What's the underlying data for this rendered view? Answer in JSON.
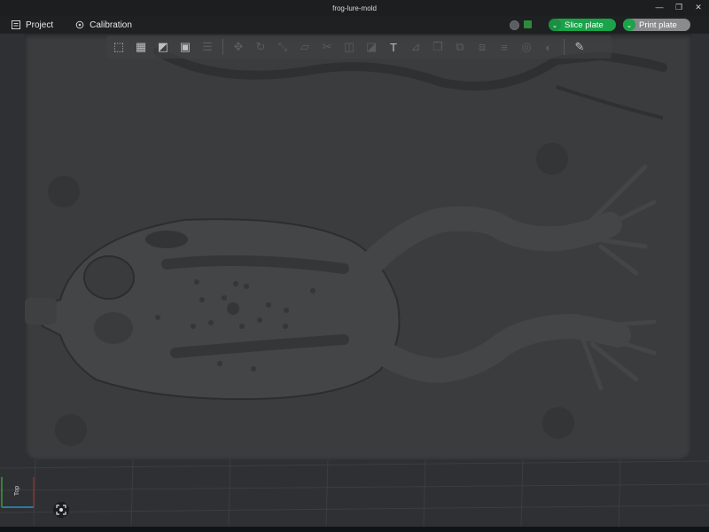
{
  "window": {
    "title": "frog-lure-mold",
    "controls": [
      "—",
      "❐",
      "✕"
    ]
  },
  "menu": {
    "project_label": "Project",
    "calibration_label": "Calibration"
  },
  "actions": {
    "slice_label": "Slice plate",
    "print_label": "Print plate",
    "dropdown_glyph": "⌄"
  },
  "viewport": {
    "view_label": "Top"
  },
  "toolbar": {
    "items": [
      {
        "icon": "add-cube-icon",
        "enabled": true
      },
      {
        "icon": "grid-icon",
        "enabled": true
      },
      {
        "icon": "auto-orient-icon",
        "enabled": true
      },
      {
        "icon": "arrange-icon",
        "enabled": true
      },
      {
        "icon": "layers-icon",
        "enabled": false
      },
      {
        "icon": "move-icon",
        "enabled": false
      },
      {
        "icon": "rotate-icon",
        "enabled": false
      },
      {
        "icon": "scale-icon",
        "enabled": false
      },
      {
        "icon": "lay-on-face-icon",
        "enabled": false
      },
      {
        "icon": "cut-icon",
        "enabled": false
      },
      {
        "icon": "support-paint-icon",
        "enabled": false
      },
      {
        "icon": "seam-paint-icon",
        "enabled": false
      },
      {
        "icon": "text-icon",
        "enabled": true
      },
      {
        "icon": "measure-icon",
        "enabled": false
      },
      {
        "icon": "assembly-icon",
        "enabled": false
      },
      {
        "icon": "split-objects-icon",
        "enabled": false
      },
      {
        "icon": "split-parts-icon",
        "enabled": false
      },
      {
        "icon": "variable-layer-icon",
        "enabled": false
      },
      {
        "icon": "boolean-icon",
        "enabled": false
      },
      {
        "icon": "color-paint-icon",
        "enabled": false
      },
      {
        "icon": "edit-icon",
        "enabled": true
      }
    ]
  },
  "colors": {
    "accent_green": "#1aa34a",
    "plate": "#3b3c3e",
    "background": "#2f3033"
  }
}
